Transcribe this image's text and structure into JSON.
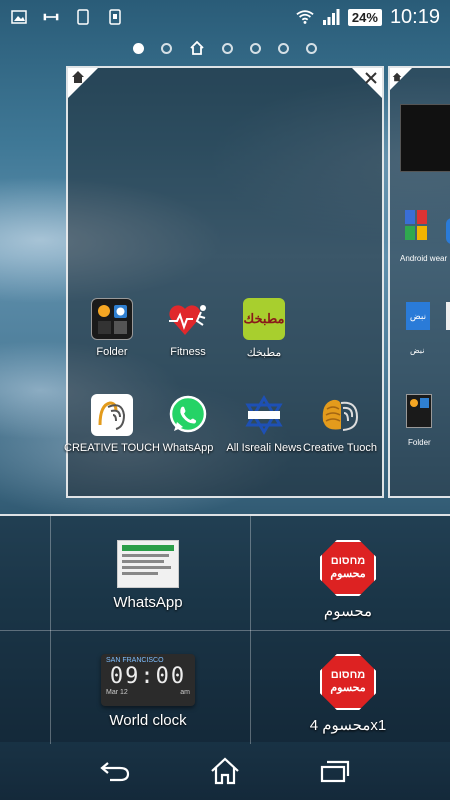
{
  "status_bar": {
    "battery": "24%",
    "time": "10:19"
  },
  "page_indicator": {
    "count": 7,
    "home_index": 2,
    "active_index": 0
  },
  "panel": {
    "apps": [
      {
        "label": "Folder",
        "icon": "folder-icon"
      },
      {
        "label": "Fitness",
        "icon": "fitness-icon"
      },
      {
        "label": "مطبخك",
        "icon": "matbakhak-icon",
        "icon_text": "مطبخك"
      },
      {
        "label": "CREATIVE TOUCH",
        "icon": "creative-touch-icon"
      },
      {
        "label": "WhatsApp",
        "icon": "whatsapp-icon"
      },
      {
        "label": "All Isreali News",
        "icon": "star-of-david-icon"
      },
      {
        "label": "Creative Tuoch",
        "icon": "creative-tuoch-icon"
      }
    ]
  },
  "peek_panel": {
    "labels": [
      "Android wear",
      "نبض",
      "Folder"
    ],
    "icon_text": "نبض"
  },
  "widgets": [
    {
      "label": "WhatsApp",
      "icon": "whatsapp-widget-preview"
    },
    {
      "label": "محسوم",
      "icon": "stop-sign-icon",
      "sign_lines": [
        "מחסום",
        "محسوم"
      ]
    },
    {
      "label": "World clock",
      "icon": "world-clock-icon",
      "city": "SAN FRANCISCO",
      "clock_time": "09:00",
      "date": "Mar 12",
      "ampm": "am"
    },
    {
      "label": "محسوم 4x1",
      "icon": "stop-sign-icon",
      "sign_lines": [
        "מחסום",
        "محسوم"
      ]
    }
  ],
  "colors": {
    "accent": "#ffffff",
    "stop_red": "#d22222",
    "whatsapp_green": "#25d366"
  }
}
